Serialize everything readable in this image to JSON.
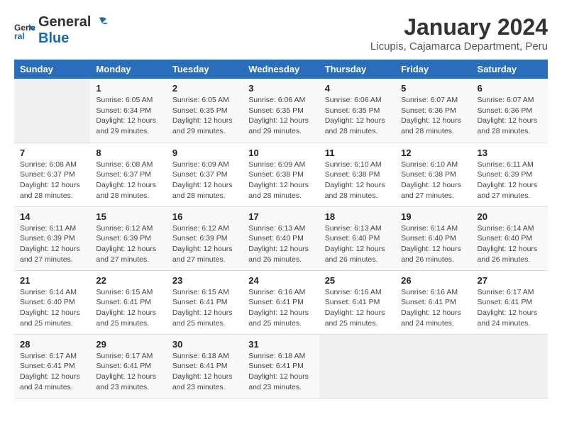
{
  "logo": {
    "line1": "General",
    "line2": "Blue"
  },
  "title": "January 2024",
  "subtitle": "Licupis, Cajamarca Department, Peru",
  "weekdays": [
    "Sunday",
    "Monday",
    "Tuesday",
    "Wednesday",
    "Thursday",
    "Friday",
    "Saturday"
  ],
  "weeks": [
    [
      {
        "day": "",
        "info": ""
      },
      {
        "day": "1",
        "info": "Sunrise: 6:05 AM\nSunset: 6:34 PM\nDaylight: 12 hours\nand 29 minutes."
      },
      {
        "day": "2",
        "info": "Sunrise: 6:05 AM\nSunset: 6:35 PM\nDaylight: 12 hours\nand 29 minutes."
      },
      {
        "day": "3",
        "info": "Sunrise: 6:06 AM\nSunset: 6:35 PM\nDaylight: 12 hours\nand 29 minutes."
      },
      {
        "day": "4",
        "info": "Sunrise: 6:06 AM\nSunset: 6:35 PM\nDaylight: 12 hours\nand 28 minutes."
      },
      {
        "day": "5",
        "info": "Sunrise: 6:07 AM\nSunset: 6:36 PM\nDaylight: 12 hours\nand 28 minutes."
      },
      {
        "day": "6",
        "info": "Sunrise: 6:07 AM\nSunset: 6:36 PM\nDaylight: 12 hours\nand 28 minutes."
      }
    ],
    [
      {
        "day": "7",
        "info": "Sunrise: 6:08 AM\nSunset: 6:37 PM\nDaylight: 12 hours\nand 28 minutes."
      },
      {
        "day": "8",
        "info": "Sunrise: 6:08 AM\nSunset: 6:37 PM\nDaylight: 12 hours\nand 28 minutes."
      },
      {
        "day": "9",
        "info": "Sunrise: 6:09 AM\nSunset: 6:37 PM\nDaylight: 12 hours\nand 28 minutes."
      },
      {
        "day": "10",
        "info": "Sunrise: 6:09 AM\nSunset: 6:38 PM\nDaylight: 12 hours\nand 28 minutes."
      },
      {
        "day": "11",
        "info": "Sunrise: 6:10 AM\nSunset: 6:38 PM\nDaylight: 12 hours\nand 28 minutes."
      },
      {
        "day": "12",
        "info": "Sunrise: 6:10 AM\nSunset: 6:38 PM\nDaylight: 12 hours\nand 27 minutes."
      },
      {
        "day": "13",
        "info": "Sunrise: 6:11 AM\nSunset: 6:39 PM\nDaylight: 12 hours\nand 27 minutes."
      }
    ],
    [
      {
        "day": "14",
        "info": "Sunrise: 6:11 AM\nSunset: 6:39 PM\nDaylight: 12 hours\nand 27 minutes."
      },
      {
        "day": "15",
        "info": "Sunrise: 6:12 AM\nSunset: 6:39 PM\nDaylight: 12 hours\nand 27 minutes."
      },
      {
        "day": "16",
        "info": "Sunrise: 6:12 AM\nSunset: 6:39 PM\nDaylight: 12 hours\nand 27 minutes."
      },
      {
        "day": "17",
        "info": "Sunrise: 6:13 AM\nSunset: 6:40 PM\nDaylight: 12 hours\nand 26 minutes."
      },
      {
        "day": "18",
        "info": "Sunrise: 6:13 AM\nSunset: 6:40 PM\nDaylight: 12 hours\nand 26 minutes."
      },
      {
        "day": "19",
        "info": "Sunrise: 6:14 AM\nSunset: 6:40 PM\nDaylight: 12 hours\nand 26 minutes."
      },
      {
        "day": "20",
        "info": "Sunrise: 6:14 AM\nSunset: 6:40 PM\nDaylight: 12 hours\nand 26 minutes."
      }
    ],
    [
      {
        "day": "21",
        "info": "Sunrise: 6:14 AM\nSunset: 6:40 PM\nDaylight: 12 hours\nand 25 minutes."
      },
      {
        "day": "22",
        "info": "Sunrise: 6:15 AM\nSunset: 6:41 PM\nDaylight: 12 hours\nand 25 minutes."
      },
      {
        "day": "23",
        "info": "Sunrise: 6:15 AM\nSunset: 6:41 PM\nDaylight: 12 hours\nand 25 minutes."
      },
      {
        "day": "24",
        "info": "Sunrise: 6:16 AM\nSunset: 6:41 PM\nDaylight: 12 hours\nand 25 minutes."
      },
      {
        "day": "25",
        "info": "Sunrise: 6:16 AM\nSunset: 6:41 PM\nDaylight: 12 hours\nand 25 minutes."
      },
      {
        "day": "26",
        "info": "Sunrise: 6:16 AM\nSunset: 6:41 PM\nDaylight: 12 hours\nand 24 minutes."
      },
      {
        "day": "27",
        "info": "Sunrise: 6:17 AM\nSunset: 6:41 PM\nDaylight: 12 hours\nand 24 minutes."
      }
    ],
    [
      {
        "day": "28",
        "info": "Sunrise: 6:17 AM\nSunset: 6:41 PM\nDaylight: 12 hours\nand 24 minutes."
      },
      {
        "day": "29",
        "info": "Sunrise: 6:17 AM\nSunset: 6:41 PM\nDaylight: 12 hours\nand 23 minutes."
      },
      {
        "day": "30",
        "info": "Sunrise: 6:18 AM\nSunset: 6:41 PM\nDaylight: 12 hours\nand 23 minutes."
      },
      {
        "day": "31",
        "info": "Sunrise: 6:18 AM\nSunset: 6:41 PM\nDaylight: 12 hours\nand 23 minutes."
      },
      {
        "day": "",
        "info": ""
      },
      {
        "day": "",
        "info": ""
      },
      {
        "day": "",
        "info": ""
      }
    ]
  ]
}
